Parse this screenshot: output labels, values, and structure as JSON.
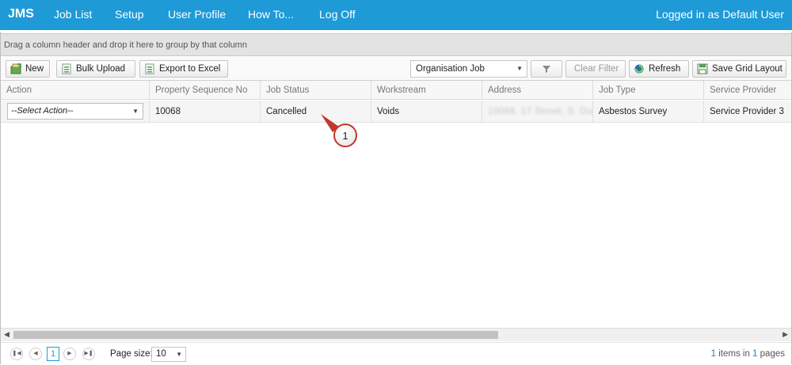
{
  "header": {
    "brand": "JMS",
    "nav": [
      "Job List",
      "Setup",
      "User Profile",
      "How To...",
      "Log Off"
    ],
    "user_status": "Logged in as Default User"
  },
  "grid": {
    "group_hint": "Drag a column header and drop it here to group by that column",
    "toolbar": {
      "new": "New",
      "bulk_upload": "Bulk Upload",
      "export_excel": "Export to Excel",
      "view_select": "Organisation Job",
      "clear_filter": "Clear Filter",
      "refresh": "Refresh",
      "save_layout": "Save Grid Layout"
    },
    "columns": [
      "Action",
      "Property Sequence No",
      "Job Status",
      "Workstream",
      "Address",
      "Job Type",
      "Service Provider"
    ],
    "rows": [
      {
        "action": "--Select Action--",
        "property_seq": "10068",
        "job_status": "Cancelled",
        "workstream": "Voids",
        "address": "10068, 17 Street, S. Dudley",
        "job_type": "Asbestos Survey",
        "service_provider": "Service Provider 3"
      }
    ]
  },
  "annotation": {
    "marker": "1"
  },
  "pager": {
    "current_page": "1",
    "page_size_label": "Page size:",
    "page_size": "10",
    "items_count": "1",
    "items_mid": "items in",
    "pages_count": "1",
    "pages_suffix": "pages"
  },
  "colors": {
    "header_bg": "#1e9ad7",
    "accent": "#1e9ad7"
  }
}
